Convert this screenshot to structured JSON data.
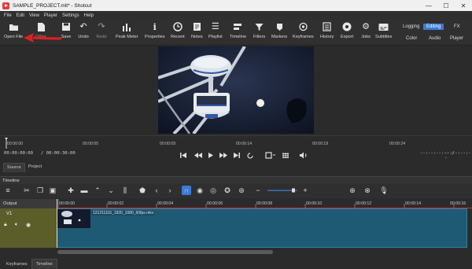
{
  "window": {
    "title": "SAMPLE_PROJECT.mlt* - Shotcut",
    "minimize": "—",
    "maximize": "☐",
    "close": "✕"
  },
  "menu": [
    "File",
    "Edit",
    "View",
    "Player",
    "Settings",
    "Help"
  ],
  "toolbar": {
    "items": [
      {
        "label": "Open File",
        "icon": "folder-icon"
      },
      {
        "label": "Other",
        "icon": "file-icon"
      },
      {
        "label": "Save",
        "icon": "save-icon"
      },
      {
        "label": "Undo",
        "icon": "undo-icon"
      },
      {
        "label": "Redo",
        "icon": "redo-icon"
      },
      {
        "label": "Peak Meter",
        "icon": "peak-meter-icon"
      },
      {
        "label": "Properties",
        "icon": "info-icon"
      },
      {
        "label": "Recent",
        "icon": "clock-icon"
      },
      {
        "label": "Notes",
        "icon": "notes-icon"
      },
      {
        "label": "Playlist",
        "icon": "playlist-icon"
      },
      {
        "label": "Timeline",
        "icon": "timeline-icon"
      },
      {
        "label": "Filters",
        "icon": "filter-icon"
      },
      {
        "label": "Markers",
        "icon": "marker-icon"
      },
      {
        "label": "Keyframes",
        "icon": "keyframes-icon"
      },
      {
        "label": "History",
        "icon": "history-icon"
      },
      {
        "label": "Export",
        "icon": "export-icon"
      },
      {
        "label": "Jobs",
        "icon": "gear-icon"
      },
      {
        "label": "Subtitles",
        "icon": "subtitles-icon"
      }
    ],
    "layouts_top": [
      "Logging",
      "Editing",
      "FX"
    ],
    "layouts_bottom": [
      "Color",
      "Audio",
      "Player"
    ],
    "active_layout": "Editing"
  },
  "annotation_color": "#e02020",
  "ruler": {
    "ticks": [
      "00:00:00",
      "00:00:05",
      "00:00:09",
      "00:00:14",
      "00:00:19",
      "00:00:24"
    ]
  },
  "transport": {
    "position": "00:00:00:00",
    "duration": "/ 00:00:30:00",
    "in_point": "--:--:--:-- /",
    "out_point": "--:--:--:--"
  },
  "source_tabs": [
    "Source",
    "Project"
  ],
  "timeline": {
    "title": "Timeline",
    "output_label": "Output",
    "track_name": "V1",
    "clip_name": "121211116_1920_1080_60fps.mkv",
    "ticks": [
      "00:00:00",
      "00:00:02",
      "00:00:04",
      "00:00:06",
      "00:00:08",
      "00:00:10",
      "00:00:12",
      "00:00:14",
      "00:00:16"
    ]
  },
  "bottom_tabs": [
    "Keyframes",
    "Timeline"
  ]
}
